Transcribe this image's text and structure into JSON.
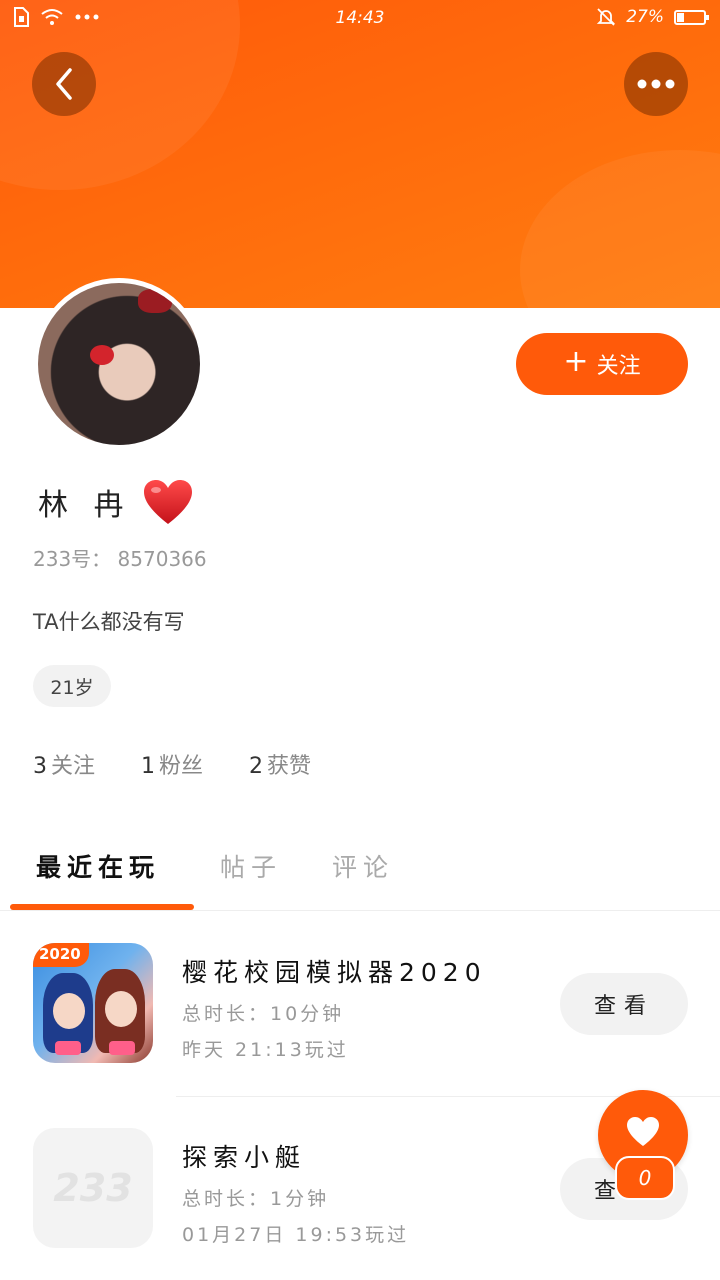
{
  "status_bar": {
    "time": "14:43",
    "battery": "27%",
    "battery_level": 0.27
  },
  "profile": {
    "name": "林 冉",
    "id_label": "233号：",
    "id_value": "8570366",
    "bio": "TA什么都没有写",
    "age": "21岁",
    "follow_button": "关注",
    "stats": [
      {
        "count": "3",
        "label": "关注"
      },
      {
        "count": "1",
        "label": "粉丝"
      },
      {
        "count": "2",
        "label": "获赞"
      }
    ]
  },
  "tabs": [
    {
      "label": "最近在玩",
      "active": true
    },
    {
      "label": "帖子",
      "active": false
    },
    {
      "label": "评论",
      "active": false
    }
  ],
  "games": [
    {
      "title": "樱花校园模拟器2020",
      "duration": "总时长：10分钟",
      "last_played": "昨天 21:13玩过",
      "button": "查看",
      "icon_badge": "2020"
    },
    {
      "title": "探索小艇",
      "duration": "总时长：1分钟",
      "last_played": "01月27日 19:53玩过",
      "button": "查看",
      "icon_text": "233"
    }
  ],
  "fab": {
    "likes": "0"
  },
  "colors": {
    "accent": "#ff5a0a",
    "header_gradient_end": "#ff7d0f"
  }
}
